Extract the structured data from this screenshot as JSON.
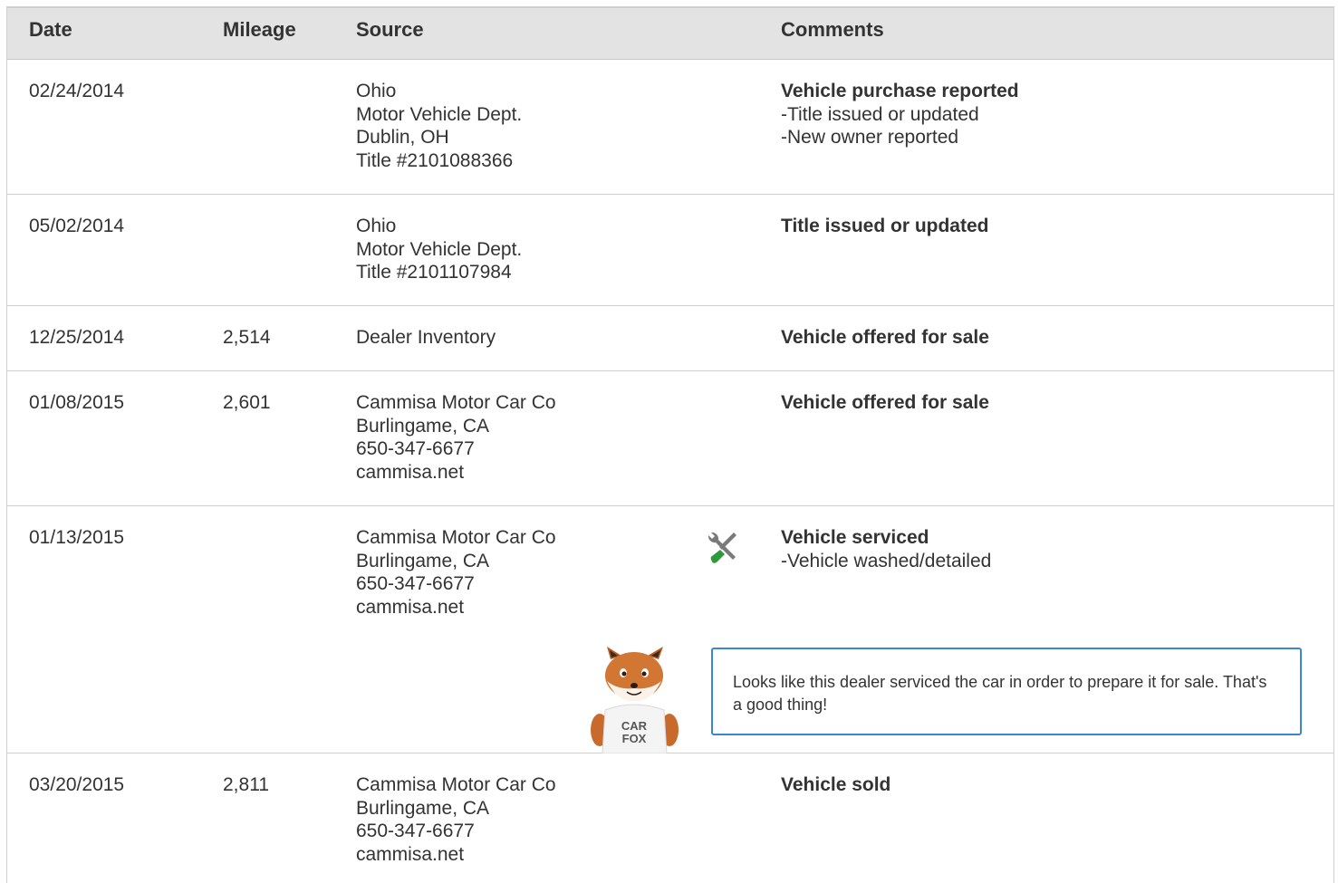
{
  "columns": {
    "date": "Date",
    "mileage": "Mileage",
    "source": "Source",
    "comments": "Comments"
  },
  "rows": [
    {
      "date": "02/24/2014",
      "mileage": "",
      "source": [
        "Ohio",
        "Motor Vehicle Dept.",
        "Dublin, OH",
        "Title #2101088366"
      ],
      "comment_title": "Vehicle purchase reported",
      "comment_details": [
        "Title issued or updated",
        "New owner reported"
      ]
    },
    {
      "date": "05/02/2014",
      "mileage": "",
      "source": [
        "Ohio",
        "Motor Vehicle Dept.",
        "Title #2101107984"
      ],
      "comment_title": "Title issued or updated",
      "comment_details": []
    },
    {
      "date": "12/25/2014",
      "mileage": "2,514",
      "source": [
        "Dealer Inventory"
      ],
      "comment_title": "Vehicle offered for sale",
      "comment_details": []
    },
    {
      "date": "01/08/2015",
      "mileage": "2,601",
      "source": [
        "Cammisa Motor Car Co",
        "Burlingame, CA",
        "650-347-6677",
        "cammisa.net"
      ],
      "comment_title": "Vehicle offered for sale",
      "comment_details": []
    },
    {
      "date": "01/13/2015",
      "mileage": "",
      "source": [
        "Cammisa Motor Car Co",
        "Burlingame, CA",
        "650-347-6677",
        "cammisa.net"
      ],
      "comment_title": "Vehicle serviced",
      "comment_details": [
        "Vehicle washed/detailed"
      ],
      "icon": "service-tools-icon",
      "tip": "Looks like this dealer serviced the car in order to prepare it for sale. That's a good thing!",
      "mascot_text": [
        "CAR",
        "FOX"
      ]
    },
    {
      "date": "03/20/2015",
      "mileage": "2,811",
      "source": [
        "Cammisa Motor Car Co",
        "Burlingame, CA",
        "650-347-6677",
        "cammisa.net"
      ],
      "comment_title": "Vehicle sold",
      "comment_details": []
    }
  ],
  "colors": {
    "header_bg": "#e3e3e3",
    "border": "#cfcfcf",
    "tip_border": "#3b86d1",
    "tool_green": "#2e9a3a"
  }
}
